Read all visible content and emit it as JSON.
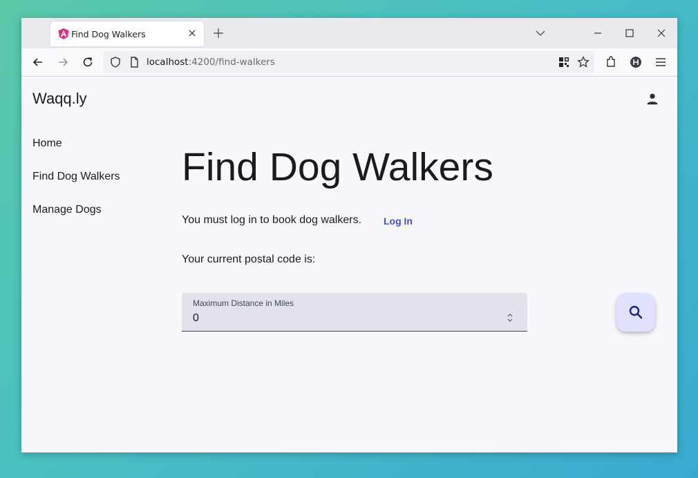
{
  "browser": {
    "tab_title": "Find Dog Walkers",
    "url_host": "localhost",
    "url_path": ":4200/find-walkers"
  },
  "app": {
    "brand": "Waqq.ly",
    "nav": [
      {
        "label": "Home"
      },
      {
        "label": "Find Dog Walkers"
      },
      {
        "label": "Manage Dogs"
      }
    ],
    "page_title": "Find Dog Walkers",
    "login_message": "You must log in to book dog walkers.",
    "login_link": "Log In",
    "postal_text": "Your current postal code is:",
    "distance_field": {
      "label": "Maximum Distance in Miles",
      "value": "0"
    }
  },
  "icons": {
    "favicon": "angular-icon",
    "account": "account-icon",
    "search": "search-icon"
  },
  "colors": {
    "accent": "#3f51c9",
    "fab_bg": "#e0e0ff",
    "field_bg": "#e1e2ec",
    "page_bg": "#f8f8fc"
  }
}
